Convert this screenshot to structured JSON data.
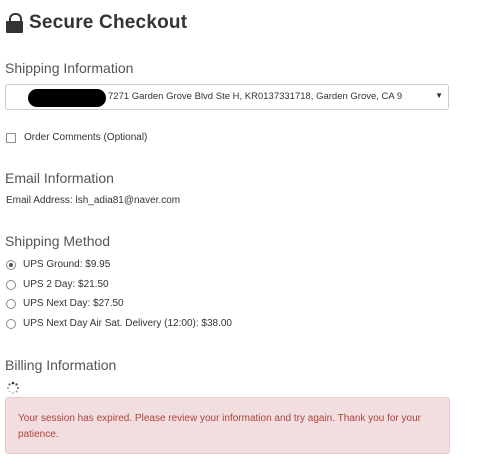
{
  "header": {
    "title": "Secure Checkout",
    "icon": "lock-icon"
  },
  "shipping_info": {
    "heading": "Shipping Information",
    "address_value": "7271 Garden Grove Blvd Ste H, KR0137331718, Garden Grove, CA 9",
    "dropdown_arrow": "▼"
  },
  "order_comments": {
    "label": "Order Comments (Optional)",
    "checked": false
  },
  "email_info": {
    "heading": "Email Information",
    "line": "Email Address: lsh_adia81@naver.com"
  },
  "shipping_method": {
    "heading": "Shipping Method",
    "options": [
      {
        "label": "UPS Ground: $9.95",
        "selected": true
      },
      {
        "label": "UPS 2 Day: $21.50",
        "selected": false
      },
      {
        "label": "UPS Next Day: $27.50",
        "selected": false
      },
      {
        "label": "UPS Next Day Air Sat. Delivery (12:00): $38.00",
        "selected": false
      }
    ]
  },
  "billing_info": {
    "heading": "Billing Information"
  },
  "alert": {
    "message": "Your session has expired. Please review your information and try again. Thank you for your patience.",
    "color": "#a94442",
    "background": "#f2dede"
  }
}
